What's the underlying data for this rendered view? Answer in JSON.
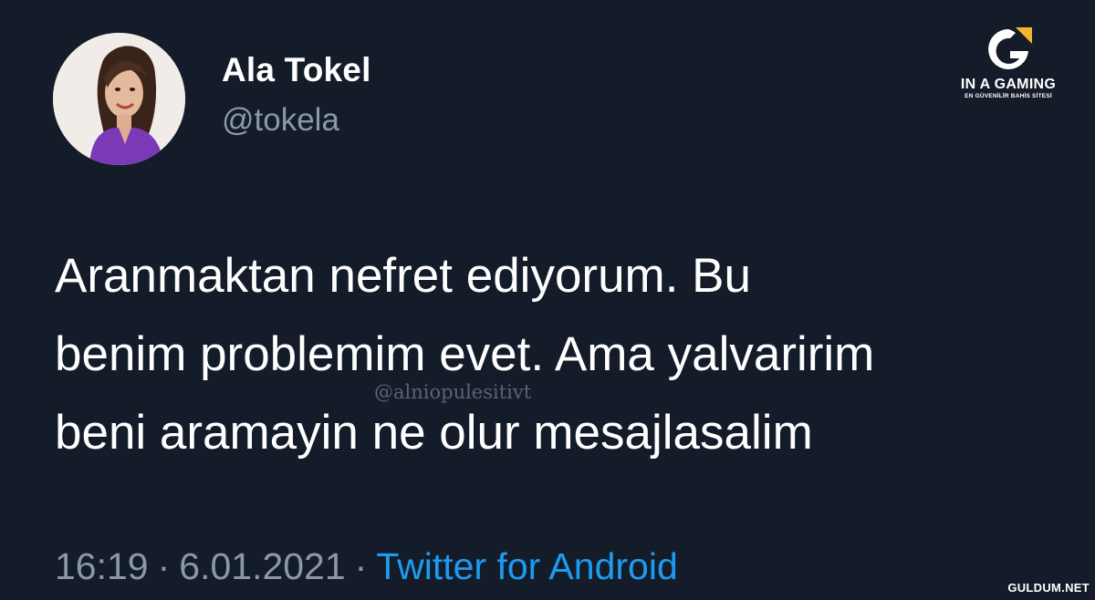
{
  "tweet": {
    "author": {
      "display_name": "Ala Tokel",
      "handle": "@tokela"
    },
    "text_lines": [
      "Aranmaktan nefret ediyorum. Bu",
      "benim problemim evet. Ama yalvaririm",
      "beni aramayin ne olur mesajlasalim"
    ],
    "time": "16:19",
    "separator": "·",
    "date": "6.01.2021",
    "source": "Twitter for Android"
  },
  "watermarks": {
    "center_handle": "@alniopulesitivt",
    "brand_name": "IN A GAMING",
    "brand_tagline": "EN GÜVENİLİR BAHİS SİTESİ",
    "site": "GULDUM.NET"
  },
  "colors": {
    "background": "#141c2a",
    "text": "#ffffff",
    "muted": "#8b98a5",
    "link": "#1d9bf0",
    "brand_accent": "#f2b632"
  }
}
